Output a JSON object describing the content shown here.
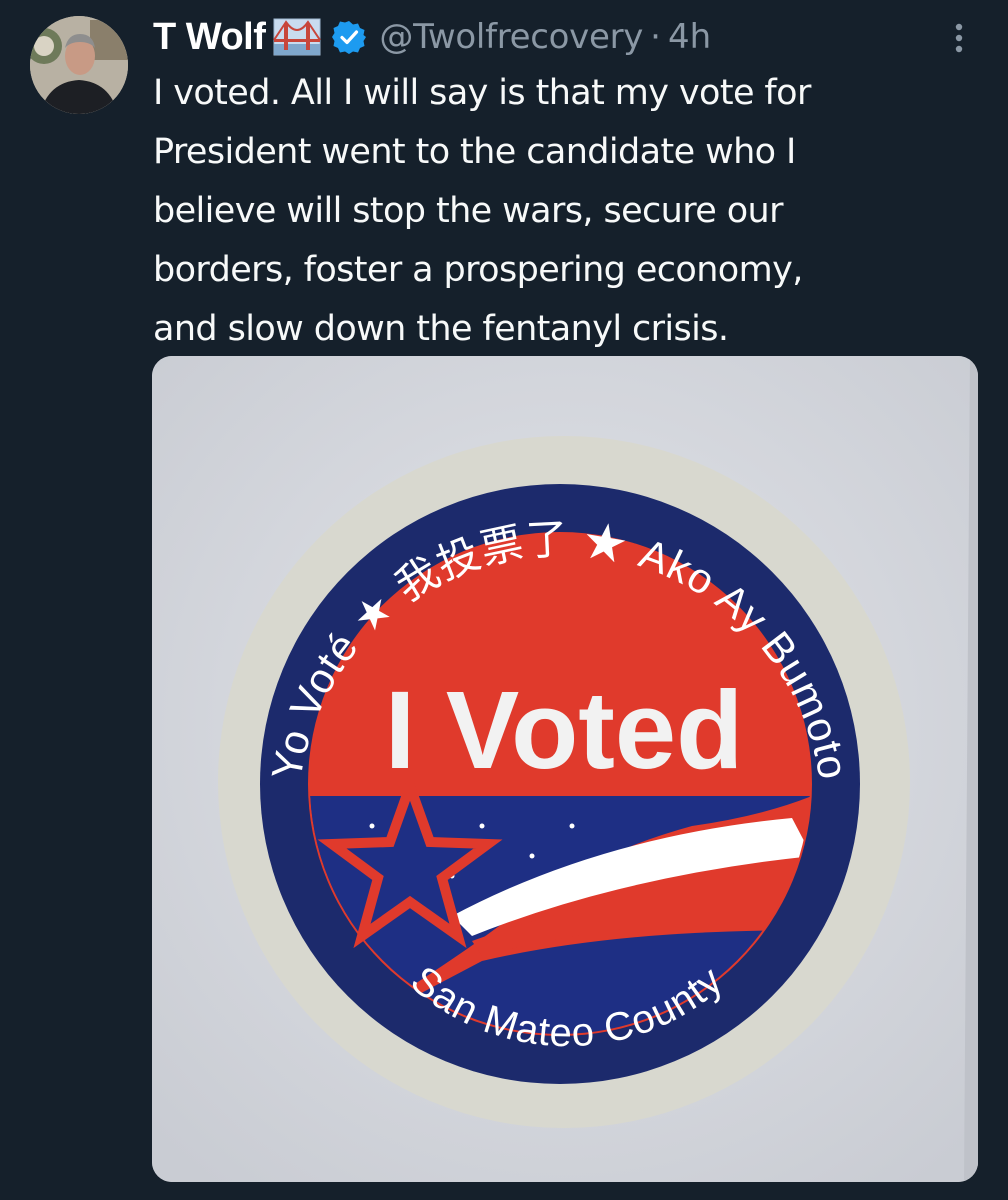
{
  "tweet": {
    "author_name": "T Wolf",
    "handle": "@Twolfrecovery",
    "separator": "·",
    "time": "4h",
    "text_lines": [
      "I voted. All I will say is that my vote for",
      "President went to the candidate who I",
      "believe will stop the wars, secure our",
      "borders, foster a prospering economy,",
      "and slow down the fentanyl crisis."
    ]
  },
  "sticker": {
    "main": "I Voted",
    "top_arc": "Yo Voté ★ 我投票了 ★ Ako Ay Bumoto",
    "bottom_arc": "San Mateo County"
  },
  "icons": {
    "verified": "verified-badge-icon",
    "flag": "golden-gate-bridge-flag-icon",
    "more": "more-options-icon"
  },
  "colors": {
    "background": "#15202b",
    "handle_gray": "#8b98a5",
    "verified_blue": "#1d9bf0",
    "sticker_navy": "#1b2a6e",
    "sticker_red": "#e03a2c"
  }
}
